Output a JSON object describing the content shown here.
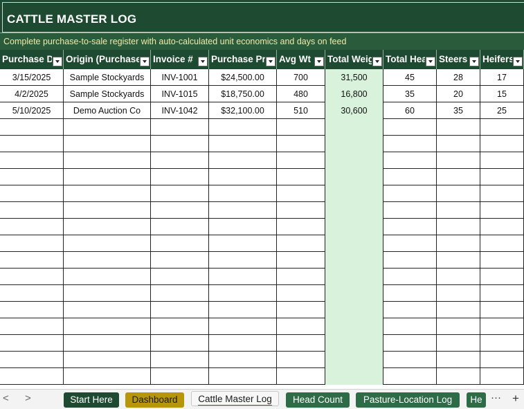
{
  "sheet": {
    "title": "CATTLE MASTER LOG",
    "subtitle": "Complete purchase-to-sale register with auto-calculated unit economics and days on feed"
  },
  "columns": [
    {
      "key": "purchase_date",
      "label": "Purchase Date"
    },
    {
      "key": "origin",
      "label": "Origin (Purchased From)"
    },
    {
      "key": "invoice",
      "label": "Invoice #"
    },
    {
      "key": "purchase_price",
      "label": "Purchase Price"
    },
    {
      "key": "avg_wt",
      "label": "Avg Wt"
    },
    {
      "key": "total_weight",
      "label": "Total Weight"
    },
    {
      "key": "total_head",
      "label": "Total Head"
    },
    {
      "key": "steers",
      "label": "Steers"
    },
    {
      "key": "heifers",
      "label": "Heifers"
    }
  ],
  "rows": [
    [
      "3/15/2025",
      "Sample Stockyards",
      "INV-1001",
      "$24,500.00",
      "700",
      "31,500",
      "45",
      "28",
      "17"
    ],
    [
      "4/2/2025",
      "Sample Stockyards",
      "INV-1015",
      "$18,750.00",
      "480",
      "16,800",
      "35",
      "20",
      "15"
    ],
    [
      "5/10/2025",
      "Demo Auction Co",
      "INV-1042",
      "$32,100.00",
      "510",
      "30,600",
      "60",
      "35",
      "25"
    ]
  ],
  "tabs": [
    {
      "label": "Start Here",
      "style": "dark"
    },
    {
      "label": "Dashboard",
      "style": "gold"
    },
    {
      "label": "Cattle Master Log",
      "style": "active"
    },
    {
      "label": "Head Count",
      "style": "mid"
    },
    {
      "label": "Pasture-Location Log",
      "style": "mid"
    },
    {
      "label": "He",
      "style": "mid"
    }
  ],
  "nav": {
    "prev": "<",
    "next": ">",
    "more": "···",
    "add": "+"
  },
  "colors": {
    "header_bg": "#1e4a31",
    "subtitle_text": "#f4e9a8",
    "highlight_col": "#d9f2dc"
  }
}
